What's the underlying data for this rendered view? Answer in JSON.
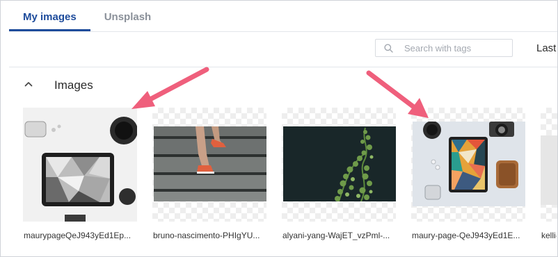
{
  "tabs": [
    {
      "label": "My images",
      "active": true
    },
    {
      "label": "Unsplash",
      "active": false
    }
  ],
  "search": {
    "placeholder": "Search with tags",
    "value": ""
  },
  "sort": {
    "label": "Last"
  },
  "section": {
    "title": "Images",
    "expanded": true
  },
  "images": [
    {
      "caption": "maurypageQeJ943yEd1Ep..."
    },
    {
      "caption": "bruno-nascimento-PHIgYU..."
    },
    {
      "caption": "alyani-yang-WajET_vzPml-..."
    },
    {
      "caption": "maury-page-QeJ943yEd1E..."
    },
    {
      "caption": "kelli-"
    }
  ],
  "colors": {
    "accent": "#1d4b9b",
    "arrow": "#ef5f7c"
  }
}
